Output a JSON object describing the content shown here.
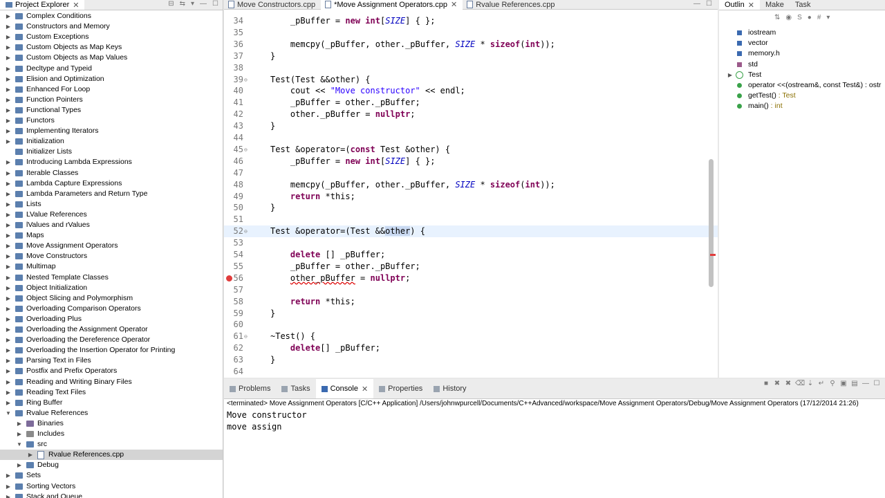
{
  "explorer": {
    "tab_label": "Project Explorer",
    "items": [
      {
        "label": "Complex Conditions",
        "level": 0,
        "expanded": false,
        "icon": "folder-icon"
      },
      {
        "label": "Constructors and Memory",
        "level": 0,
        "expanded": false,
        "icon": "folder-icon"
      },
      {
        "label": "Custom Exceptions",
        "level": 0,
        "expanded": false,
        "icon": "folder-icon"
      },
      {
        "label": "Custom Objects as Map Keys",
        "level": 0,
        "expanded": false,
        "icon": "folder-icon"
      },
      {
        "label": "Custom Objects as Map Values",
        "level": 0,
        "expanded": false,
        "icon": "folder-icon"
      },
      {
        "label": "Decltype and Typeid",
        "level": 0,
        "expanded": false,
        "icon": "folder-icon"
      },
      {
        "label": "Elision and Optimization",
        "level": 0,
        "expanded": false,
        "icon": "folder-icon"
      },
      {
        "label": "Enhanced For Loop",
        "level": 0,
        "expanded": false,
        "icon": "folder-icon"
      },
      {
        "label": "Function Pointers",
        "level": 0,
        "expanded": false,
        "icon": "folder-icon"
      },
      {
        "label": "Functional Types",
        "level": 0,
        "expanded": false,
        "icon": "folder-icon"
      },
      {
        "label": "Functors",
        "level": 0,
        "expanded": false,
        "icon": "folder-icon"
      },
      {
        "label": "Implementing Iterators",
        "level": 0,
        "expanded": false,
        "icon": "folder-icon"
      },
      {
        "label": "Initialization",
        "level": 0,
        "expanded": false,
        "icon": "folder-icon"
      },
      {
        "label": "Initializer Lists",
        "level": 0,
        "expanded": null,
        "icon": "folder-icon"
      },
      {
        "label": "Introducing Lambda Expressions",
        "level": 0,
        "expanded": false,
        "icon": "folder-icon"
      },
      {
        "label": "Iterable Classes",
        "level": 0,
        "expanded": false,
        "icon": "folder-icon"
      },
      {
        "label": "Lambda Capture Expressions",
        "level": 0,
        "expanded": false,
        "icon": "folder-icon"
      },
      {
        "label": "Lambda Parameters and Return Type",
        "level": 0,
        "expanded": false,
        "icon": "folder-icon"
      },
      {
        "label": "Lists",
        "level": 0,
        "expanded": false,
        "icon": "folder-icon"
      },
      {
        "label": "LValue References",
        "level": 0,
        "expanded": false,
        "icon": "folder-icon"
      },
      {
        "label": "lValues and rValues",
        "level": 0,
        "expanded": false,
        "icon": "folder-icon"
      },
      {
        "label": "Maps",
        "level": 0,
        "expanded": false,
        "icon": "folder-icon"
      },
      {
        "label": "Move Assignment Operators",
        "level": 0,
        "expanded": false,
        "icon": "folder-icon"
      },
      {
        "label": "Move Constructors",
        "level": 0,
        "expanded": false,
        "icon": "folder-icon"
      },
      {
        "label": "Multimap",
        "level": 0,
        "expanded": false,
        "icon": "folder-icon"
      },
      {
        "label": "Nested Template Classes",
        "level": 0,
        "expanded": false,
        "icon": "folder-icon"
      },
      {
        "label": "Object Initialization",
        "level": 0,
        "expanded": false,
        "icon": "folder-icon"
      },
      {
        "label": "Object Slicing and Polymorphism",
        "level": 0,
        "expanded": false,
        "icon": "folder-icon"
      },
      {
        "label": "Overloading Comparison Operators",
        "level": 0,
        "expanded": false,
        "icon": "folder-icon"
      },
      {
        "label": "Overloading Plus",
        "level": 0,
        "expanded": false,
        "icon": "folder-icon"
      },
      {
        "label": "Overloading the Assignment Operator",
        "level": 0,
        "expanded": false,
        "icon": "folder-icon"
      },
      {
        "label": "Overloading the Dereference Operator",
        "level": 0,
        "expanded": false,
        "icon": "folder-icon"
      },
      {
        "label": "Overloading the Insertion Operator for Printing",
        "level": 0,
        "expanded": false,
        "icon": "folder-icon"
      },
      {
        "label": "Parsing Text in Files",
        "level": 0,
        "expanded": false,
        "icon": "folder-icon"
      },
      {
        "label": "Postfix and Prefix Operators",
        "level": 0,
        "expanded": false,
        "icon": "folder-icon"
      },
      {
        "label": "Reading and Writing Binary Files",
        "level": 0,
        "expanded": false,
        "icon": "folder-icon"
      },
      {
        "label": "Reading Text Files",
        "level": 0,
        "expanded": false,
        "icon": "folder-icon"
      },
      {
        "label": "Ring Buffer",
        "level": 0,
        "expanded": false,
        "icon": "folder-icon"
      },
      {
        "label": "Rvalue References",
        "level": 0,
        "expanded": true,
        "icon": "folder-icon"
      },
      {
        "label": "Binaries",
        "level": 1,
        "expanded": false,
        "icon": "binaries-icon"
      },
      {
        "label": "Includes",
        "level": 1,
        "expanded": false,
        "icon": "includes-icon"
      },
      {
        "label": "src",
        "level": 1,
        "expanded": true,
        "icon": "folder-icon"
      },
      {
        "label": "Rvalue References.cpp",
        "level": 2,
        "expanded": false,
        "icon": "cpp-file-icon",
        "selected": true
      },
      {
        "label": "Debug",
        "level": 1,
        "expanded": false,
        "icon": "folder-icon"
      },
      {
        "label": "Sets",
        "level": 0,
        "expanded": false,
        "icon": "folder-icon"
      },
      {
        "label": "Sorting Vectors",
        "level": 0,
        "expanded": false,
        "icon": "folder-icon"
      },
      {
        "label": "Stack and Queue",
        "level": 0,
        "expanded": false,
        "icon": "folder-icon"
      }
    ]
  },
  "editor": {
    "tabs": [
      {
        "label": "Move Constructors.cpp",
        "active": false,
        "closable": false
      },
      {
        "label": "*Move Assignment Operators.cpp",
        "active": true,
        "closable": true
      },
      {
        "label": "Rvalue References.cpp",
        "active": false,
        "closable": false
      }
    ],
    "lines": [
      {
        "n": "34",
        "text": "    _pBuffer = new int[SIZE] { };"
      },
      {
        "n": "35",
        "text": ""
      },
      {
        "n": "36",
        "text": "    memcpy(_pBuffer, other._pBuffer, SIZE * sizeof(int));"
      },
      {
        "n": "37",
        "text": "}"
      },
      {
        "n": "38",
        "text": ""
      },
      {
        "n": "39",
        "text": "Test(Test &&other) {",
        "fold": true
      },
      {
        "n": "40",
        "text": "    cout << \"Move constructor\" << endl;"
      },
      {
        "n": "41",
        "text": "    _pBuffer = other._pBuffer;"
      },
      {
        "n": "42",
        "text": "    other._pBuffer = nullptr;"
      },
      {
        "n": "43",
        "text": "}"
      },
      {
        "n": "44",
        "text": ""
      },
      {
        "n": "45",
        "text": "Test &operator=(const Test &other) {",
        "fold": true
      },
      {
        "n": "46",
        "text": "    _pBuffer = new int[SIZE] { };"
      },
      {
        "n": "47",
        "text": ""
      },
      {
        "n": "48",
        "text": "    memcpy(_pBuffer, other._pBuffer, SIZE * sizeof(int));"
      },
      {
        "n": "49",
        "text": "    return *this;"
      },
      {
        "n": "50",
        "text": "}"
      },
      {
        "n": "51",
        "text": ""
      },
      {
        "n": "52",
        "text": "Test &operator=(Test &&other) {",
        "fold": true,
        "highlight": true
      },
      {
        "n": "53",
        "text": ""
      },
      {
        "n": "54",
        "text": "    delete [] _pBuffer;"
      },
      {
        "n": "55",
        "text": "    _pBuffer = other._pBuffer;"
      },
      {
        "n": "56",
        "text": "    other_pBuffer = nullptr;",
        "error": true
      },
      {
        "n": "57",
        "text": ""
      },
      {
        "n": "58",
        "text": "    return *this;"
      },
      {
        "n": "59",
        "text": "}"
      },
      {
        "n": "60",
        "text": ""
      },
      {
        "n": "61",
        "text": "~Test() {",
        "fold": true
      },
      {
        "n": "62",
        "text": "    delete[] _pBuffer;"
      },
      {
        "n": "63",
        "text": "}"
      },
      {
        "n": "64",
        "text": ""
      }
    ]
  },
  "outline": {
    "tabs": [
      {
        "label": "Outlin",
        "active": true
      },
      {
        "label": "Make",
        "active": false
      },
      {
        "label": "Task",
        "active": false
      }
    ],
    "items": [
      {
        "label": "iostream",
        "type": "",
        "icon": "include-icon"
      },
      {
        "label": "vector",
        "type": "",
        "icon": "include-icon"
      },
      {
        "label": "memory.h",
        "type": "",
        "icon": "include-icon"
      },
      {
        "label": "std",
        "type": "",
        "icon": "namespace-icon"
      },
      {
        "label": "Test",
        "type": "",
        "icon": "class-icon",
        "expandable": true
      },
      {
        "label": "operator <<(ostream&, const Test&) : ostr",
        "type": "",
        "icon": "function-icon"
      },
      {
        "label": "getTest()",
        "type": " : Test",
        "icon": "function-icon"
      },
      {
        "label": "main()",
        "type": " : int",
        "icon": "function-icon"
      }
    ]
  },
  "console": {
    "tabs": [
      {
        "label": "Problems",
        "active": false,
        "icon": "problems-icon"
      },
      {
        "label": "Tasks",
        "active": false,
        "icon": "tasks-icon"
      },
      {
        "label": "Console",
        "active": true,
        "icon": "console-icon"
      },
      {
        "label": "Properties",
        "active": false,
        "icon": "properties-icon"
      },
      {
        "label": "History",
        "active": false,
        "icon": "history-icon"
      }
    ],
    "terminated_line": "<terminated> Move Assignment Operators [C/C++ Application] /Users/johnwpurcell/Documents/C++Advanced/workspace/Move Assignment Operators/Debug/Move Assignment Operators (17/12/2014 21:26)",
    "output": [
      "Move constructor",
      "move assign"
    ]
  }
}
